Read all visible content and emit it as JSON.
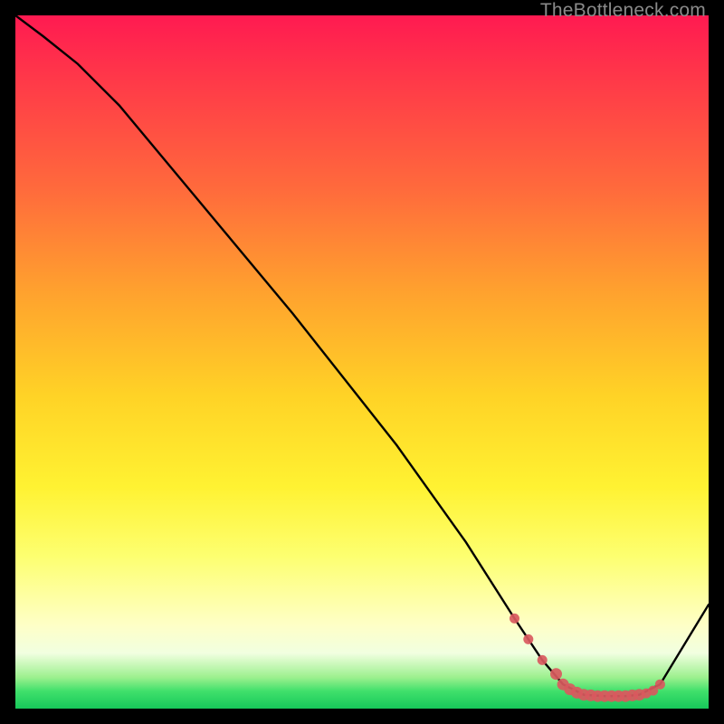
{
  "watermark": "TheBottleneck.com",
  "colors": {
    "background": "#000000",
    "gradient_top": "#ff1a51",
    "gradient_mid": "#ffd326",
    "gradient_bottom": "#17c85a",
    "curve": "#000000",
    "marker": "#d9595e",
    "watermark_text": "#8a8a8a"
  },
  "chart_data": {
    "type": "line",
    "title": "",
    "xlabel": "",
    "ylabel": "",
    "xlim": [
      0,
      100
    ],
    "ylim": [
      0,
      100
    ],
    "series": [
      {
        "name": "bottleneck-curve",
        "x": [
          0,
          4,
          9,
          15,
          25,
          40,
          55,
          65,
          72,
          76,
          79,
          82,
          85,
          88,
          90,
          93,
          100
        ],
        "y": [
          100,
          97,
          93,
          87,
          75,
          57,
          38,
          24,
          13,
          7,
          3.5,
          2,
          1.8,
          1.8,
          2,
          3.5,
          15
        ]
      }
    ],
    "markers": {
      "name": "highlighted-range",
      "x": [
        72,
        74,
        76,
        78,
        79,
        80,
        81,
        82,
        83,
        84,
        85,
        86,
        87,
        88,
        89,
        90,
        91,
        92,
        93
      ],
      "y": [
        13,
        10,
        7,
        5,
        3.5,
        2.8,
        2.3,
        2.0,
        1.9,
        1.8,
        1.8,
        1.8,
        1.8,
        1.8,
        1.9,
        2.0,
        2.2,
        2.6,
        3.5
      ]
    },
    "annotations": []
  }
}
